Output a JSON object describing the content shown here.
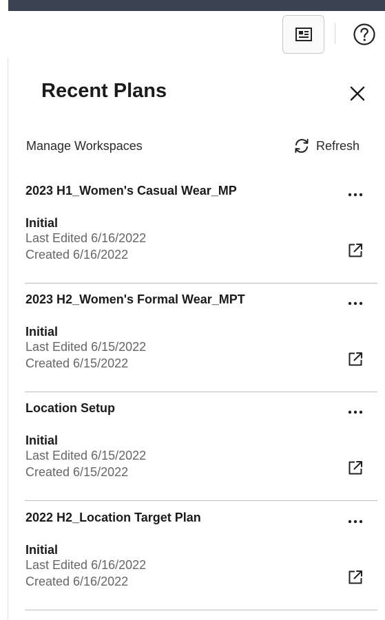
{
  "toolbar": {
    "card_view_icon": "card-view-icon",
    "help_icon": "help-circle-icon"
  },
  "panel": {
    "title": "Recent Plans",
    "close_icon": "close-icon",
    "manage_label": "Manage Workspaces",
    "refresh_label": "Refresh",
    "refresh_icon": "refresh-icon"
  },
  "plans": [
    {
      "name": "2023 H1_Women's Casual Wear_MP",
      "status": "Initial",
      "last_edited": "Last Edited 6/16/2022",
      "created": "Created 6/16/2022"
    },
    {
      "name": "2023 H2_Women's Formal Wear_MPT",
      "status": "Initial",
      "last_edited": "Last Edited 6/15/2022",
      "created": "Created 6/15/2022"
    },
    {
      "name": "Location Setup",
      "status": "Initial",
      "last_edited": "Last Edited 6/15/2022",
      "created": "Created 6/15/2022"
    },
    {
      "name": "2022 H2_Location Target Plan",
      "status": "Initial",
      "last_edited": "Last Edited 6/16/2022",
      "created": "Created 6/16/2022"
    }
  ],
  "icons": {
    "more": "more-options-icon",
    "open": "open-in-new-icon"
  },
  "colors": {
    "header_bar": "#3b4350",
    "text_primary": "#1b1b1b",
    "text_secondary": "#666666",
    "divider": "#bdbdbd"
  }
}
